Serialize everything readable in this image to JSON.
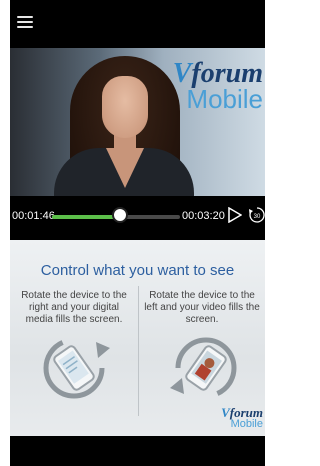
{
  "header": {
    "menu_icon": "hamburger-menu-icon"
  },
  "video": {
    "logo_brand": "forum",
    "logo_sub": "Mobile"
  },
  "player": {
    "elapsed": "00:01:46",
    "total": "00:03:20",
    "progress": 0.53,
    "play_icon": "play-icon",
    "replay_icon": "replay-30-icon",
    "replay_label": "30",
    "colors": {
      "progress": "#5cc04a",
      "track": "#4a4a4a"
    }
  },
  "instructions": {
    "title": "Control what you want to see",
    "left_text": "Rotate the device to the right and your digital media fills the screen.",
    "right_text": "Rotate the device to the left and your video fills the screen.",
    "logo_brand": "forum",
    "logo_sub": "Mobile",
    "colors": {
      "title": "#2d5fa0"
    }
  }
}
